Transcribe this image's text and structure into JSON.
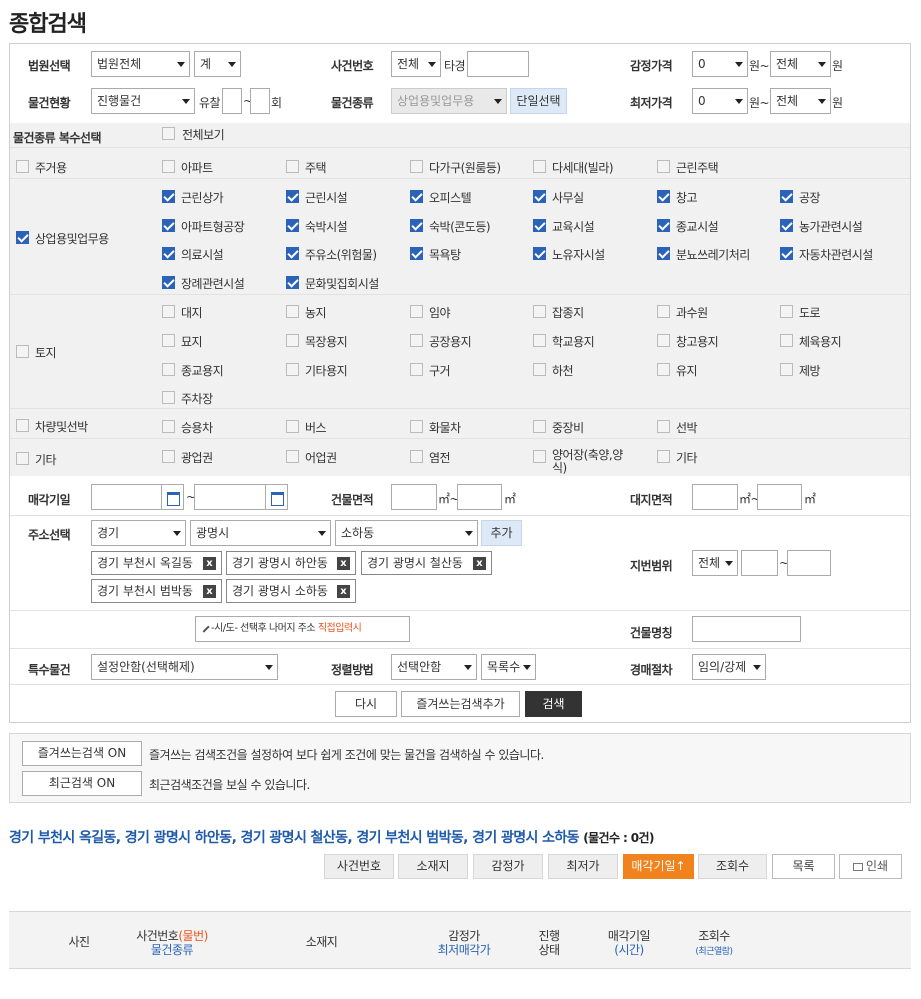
{
  "page_title": "종합검색",
  "form": {
    "court_label": "법원선택",
    "court_value": "법원전체",
    "court_sub_value": "계",
    "case_no_label": "사건번호",
    "case_no_select": "전체",
    "case_no_unit": "타경",
    "appraisal_label": "감정가격",
    "appraisal_min": "0",
    "appraisal_max": "전체",
    "won": "원",
    "won_tilde": "원~",
    "status_label": "물건현황",
    "status_value": "진행물건",
    "fail_label": "유찰",
    "tilde": "~",
    "times": "회",
    "type_label": "물건종류",
    "type_value": "상업용및업무용",
    "single_select_btn": "단일선택",
    "min_price_label": "최저가격",
    "min_price_min": "0",
    "min_price_max": "전체"
  },
  "multi": {
    "header": "물건종류 복수선택",
    "view_all": "전체보기",
    "groups": [
      {
        "name": "주거용",
        "checked": false,
        "items": [
          {
            "label": "아파트",
            "checked": false
          },
          {
            "label": "주택",
            "checked": false
          },
          {
            "label": "다가구(원룸등)",
            "checked": false
          },
          {
            "label": "다세대(빌라)",
            "checked": false
          },
          {
            "label": "근린주택",
            "checked": false
          }
        ]
      },
      {
        "name": "상업용및업무용",
        "checked": true,
        "items": [
          {
            "label": "근린상가",
            "checked": true
          },
          {
            "label": "근린시설",
            "checked": true
          },
          {
            "label": "오피스텔",
            "checked": true
          },
          {
            "label": "사무실",
            "checked": true
          },
          {
            "label": "창고",
            "checked": true
          },
          {
            "label": "공장",
            "checked": true
          },
          {
            "label": "아파트형공장",
            "checked": true
          },
          {
            "label": "숙박시설",
            "checked": true
          },
          {
            "label": "숙박(콘도등)",
            "checked": true
          },
          {
            "label": "교육시설",
            "checked": true
          },
          {
            "label": "종교시설",
            "checked": true
          },
          {
            "label": "농가관련시설",
            "checked": true
          },
          {
            "label": "의료시설",
            "checked": true
          },
          {
            "label": "주유소(위험물)",
            "checked": true
          },
          {
            "label": "목욕탕",
            "checked": true
          },
          {
            "label": "노유자시설",
            "checked": true
          },
          {
            "label": "분뇨쓰레기처리",
            "checked": true
          },
          {
            "label": "자동차관련시설",
            "checked": true
          },
          {
            "label": "장례관련시설",
            "checked": true
          },
          {
            "label": "문화및집회시설",
            "checked": true
          }
        ]
      },
      {
        "name": "토지",
        "checked": false,
        "items": [
          {
            "label": "대지",
            "checked": false
          },
          {
            "label": "농지",
            "checked": false
          },
          {
            "label": "임야",
            "checked": false
          },
          {
            "label": "잡종지",
            "checked": false
          },
          {
            "label": "과수원",
            "checked": false
          },
          {
            "label": "도로",
            "checked": false
          },
          {
            "label": "묘지",
            "checked": false
          },
          {
            "label": "목장용지",
            "checked": false
          },
          {
            "label": "공장용지",
            "checked": false
          },
          {
            "label": "학교용지",
            "checked": false
          },
          {
            "label": "창고용지",
            "checked": false
          },
          {
            "label": "체육용지",
            "checked": false
          },
          {
            "label": "종교용지",
            "checked": false
          },
          {
            "label": "기타용지",
            "checked": false
          },
          {
            "label": "구거",
            "checked": false
          },
          {
            "label": "하천",
            "checked": false
          },
          {
            "label": "유지",
            "checked": false
          },
          {
            "label": "제방",
            "checked": false
          },
          {
            "label": "주차장",
            "checked": false
          }
        ]
      },
      {
        "name": "차량및선박",
        "checked": false,
        "items": [
          {
            "label": "승용차",
            "checked": false
          },
          {
            "label": "버스",
            "checked": false
          },
          {
            "label": "화물차",
            "checked": false
          },
          {
            "label": "중장비",
            "checked": false
          },
          {
            "label": "선박",
            "checked": false
          }
        ]
      },
      {
        "name": "기타",
        "checked": false,
        "items": [
          {
            "label": "광업권",
            "checked": false
          },
          {
            "label": "어업권",
            "checked": false
          },
          {
            "label": "염전",
            "checked": false
          },
          {
            "label": "양어장(축양,양식)",
            "checked": false
          },
          {
            "label": "기타",
            "checked": false
          }
        ]
      }
    ]
  },
  "lower": {
    "sale_date_label": "매각기일",
    "tilde": "~",
    "building_area_label": "건물면적",
    "sqm": "㎡",
    "sqm_tilde": "㎡~",
    "land_area_label": "대지면적",
    "address_label": "주소선택",
    "addr_sido": "경기",
    "addr_sigungu": "광명시",
    "addr_dong": "소하동",
    "add_btn": "추가",
    "tags": [
      "경기 부천시 옥길동",
      "경기 광명시 하안동",
      "경기 광명시 철산동",
      "경기 부천시 범박동",
      "경기 광명시 소하동"
    ],
    "tag_remove": "x",
    "lot_range_label": "지번범위",
    "lot_range_value": "전체",
    "direct_input_hint": "-시/도- 선택후 나머지 주소",
    "direct_input_highlight": "직접입력시",
    "building_name_label": "건물명칭",
    "special_label": "특수물건",
    "special_value": "설정안함(선택해제)",
    "sort_label": "정렬방법",
    "sort_value": "선택안함",
    "sort_order": "목록수",
    "procedure_label": "경매절차",
    "procedure_value": "임의/강제",
    "reset_btn": "다시",
    "fav_add_btn": "즐겨쓰는검색추가",
    "search_btn": "검색"
  },
  "favorites": {
    "fav_btn": "즐겨쓰는검색 ON",
    "fav_desc": "즐겨쓰는 검색조건을 설정하여 보다 쉽게 조건에 맞는 물건을 검색하실 수 있습니다.",
    "recent_btn": "최근검색 ON",
    "recent_desc": "최근검색조건을 보실 수 있습니다."
  },
  "results": {
    "title": "경기 부천시 옥길동, 경기 광명시 하안동, 경기 광명시 철산동, 경기 부천시 범박동, 경기 광명시 소하동",
    "count": "(물건수 : 0건)",
    "sort_buttons": [
      "사건번호",
      "소재지",
      "감정가",
      "최저가",
      "매각기일↑",
      "조회수"
    ],
    "list_btn": "목록",
    "print_btn": "인쇄",
    "columns": {
      "photo": "사진",
      "case_no": "사건번호",
      "item_no": "(물번)",
      "item_type": "물건종류",
      "location": "소재지",
      "appraisal": "감정가",
      "min_price": "최저매각가",
      "progress": "진행",
      "status": "상태",
      "sale_date": "매각기일",
      "time": "(시간)",
      "views": "조회수",
      "recent_view": "(최근열람)"
    }
  },
  "colors": {
    "accent_blue": "#2b63b8",
    "title_blue": "#1f5ba8",
    "active_orange": "#f0831e",
    "highlight_orange": "#e8561e"
  }
}
